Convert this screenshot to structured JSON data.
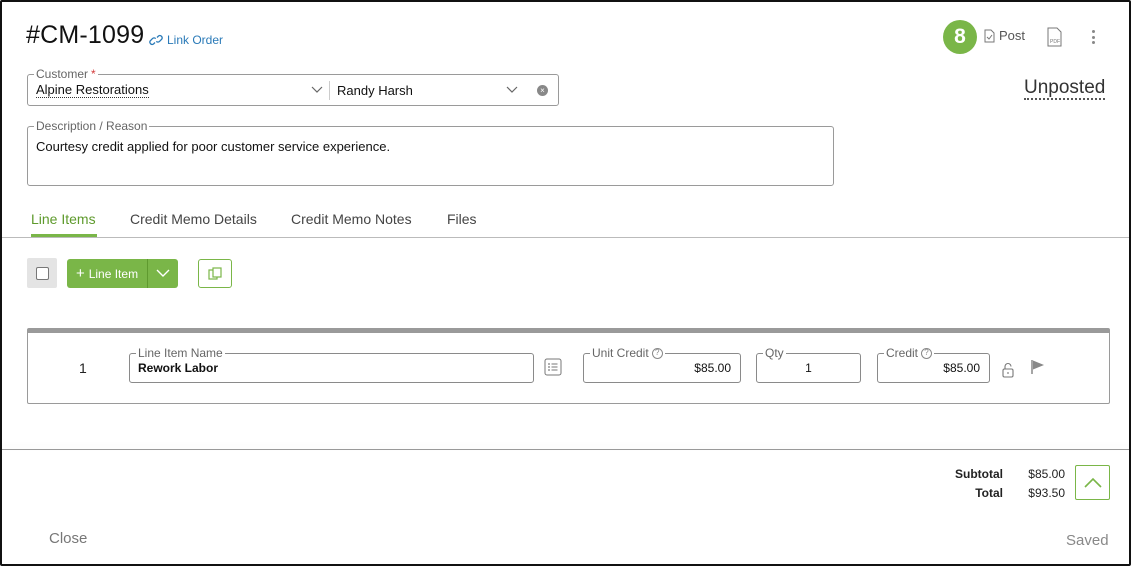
{
  "header": {
    "title": "#CM-1099",
    "link_order_label": "Link Order",
    "badge_count": "8",
    "post_label": "Post",
    "status": "Unposted"
  },
  "customer": {
    "label": "Customer",
    "required_mark": "*",
    "name": "Alpine Restorations",
    "contact": "Randy Harsh"
  },
  "description": {
    "label": "Description / Reason",
    "value": "Courtesy credit applied for poor customer service experience."
  },
  "tabs": [
    {
      "label": "Line Items"
    },
    {
      "label": "Credit Memo Details"
    },
    {
      "label": "Credit Memo Notes"
    },
    {
      "label": "Files"
    }
  ],
  "toolbar": {
    "add_line_label": "Line Item"
  },
  "line_items": [
    {
      "number": "1",
      "name_label": "Line Item Name",
      "name": "Rework Labor",
      "unit_credit_label": "Unit Credit",
      "unit_credit": "$85.00",
      "qty_label": "Qty",
      "qty": "1",
      "credit_label": "Credit",
      "credit": "$85.00"
    }
  ],
  "totals": {
    "subtotal_label": "Subtotal",
    "subtotal": "$85.00",
    "total_label": "Total",
    "total": "$93.50"
  },
  "footer": {
    "close_label": "Close",
    "saved_label": "Saved"
  },
  "colors": {
    "accent": "#7ab648",
    "link": "#2a7ab8",
    "required": "#d43c3c"
  }
}
